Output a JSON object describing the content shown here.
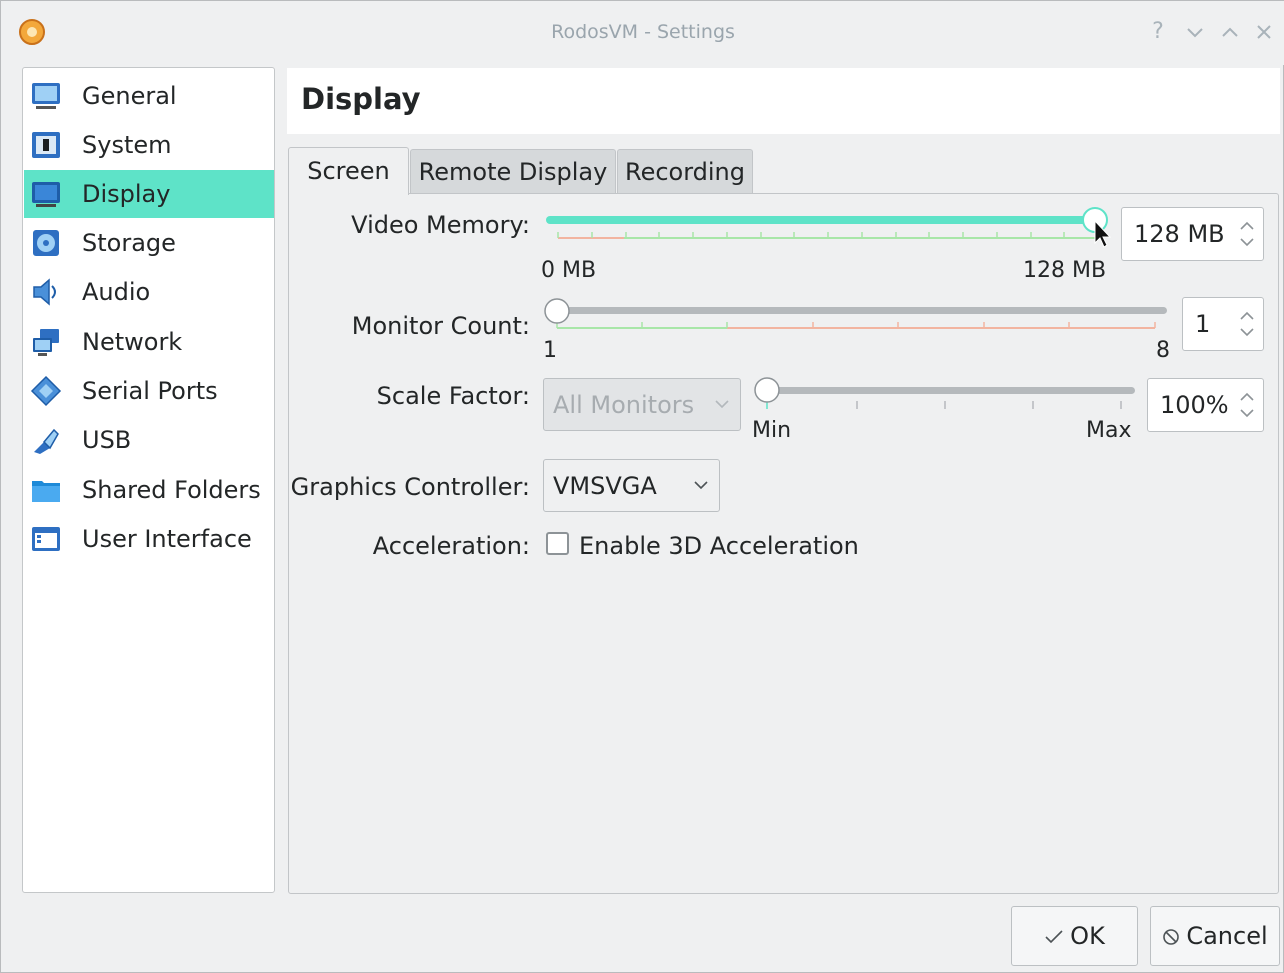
{
  "window": {
    "title": "RodosVM - Settings",
    "controls": [
      "?",
      "⌄",
      "⌃",
      "✕"
    ]
  },
  "sidebar": {
    "items": [
      {
        "label": "General",
        "icon": "monitor-icon"
      },
      {
        "label": "System",
        "icon": "chip-icon"
      },
      {
        "label": "Display",
        "icon": "display-icon",
        "selected": true
      },
      {
        "label": "Storage",
        "icon": "disk-icon"
      },
      {
        "label": "Audio",
        "icon": "speaker-icon"
      },
      {
        "label": "Network",
        "icon": "network-icon"
      },
      {
        "label": "Serial Ports",
        "icon": "serial-port-icon"
      },
      {
        "label": "USB",
        "icon": "usb-icon"
      },
      {
        "label": "Shared Folders",
        "icon": "folder-icon"
      },
      {
        "label": "User Interface",
        "icon": "window-icon"
      }
    ]
  },
  "page": {
    "title": "Display"
  },
  "tabs": [
    {
      "label": "Screen",
      "active": true
    },
    {
      "label": "Remote Display",
      "active": false
    },
    {
      "label": "Recording",
      "active": false
    }
  ],
  "screen": {
    "video_memory": {
      "label": "Video Memory:",
      "value": "128 MB",
      "min_label": "0 MB",
      "max_label": "128 MB",
      "fraction": 1.0
    },
    "monitor_count": {
      "label": "Monitor Count:",
      "value": "1",
      "min_label": "1",
      "max_label": "8",
      "fraction": 0.0
    },
    "scale_factor": {
      "label": "Scale Factor:",
      "combo_value": "All Monitors",
      "value": "100%",
      "min_label": "Min",
      "max_label": "Max",
      "fraction": 0.0
    },
    "graphics_controller": {
      "label": "Graphics Controller:",
      "value": "VMSVGA"
    },
    "acceleration": {
      "label": "Acceleration:",
      "checkbox_label": "Enable 3D Acceleration",
      "checked": false
    }
  },
  "buttons": {
    "ok": "OK",
    "cancel": "Cancel"
  },
  "colors": {
    "accent": "#5ee3c8",
    "selection": "#5ee3c8",
    "recommended": "#a8e6a8",
    "warning": "#f2b4a0"
  }
}
